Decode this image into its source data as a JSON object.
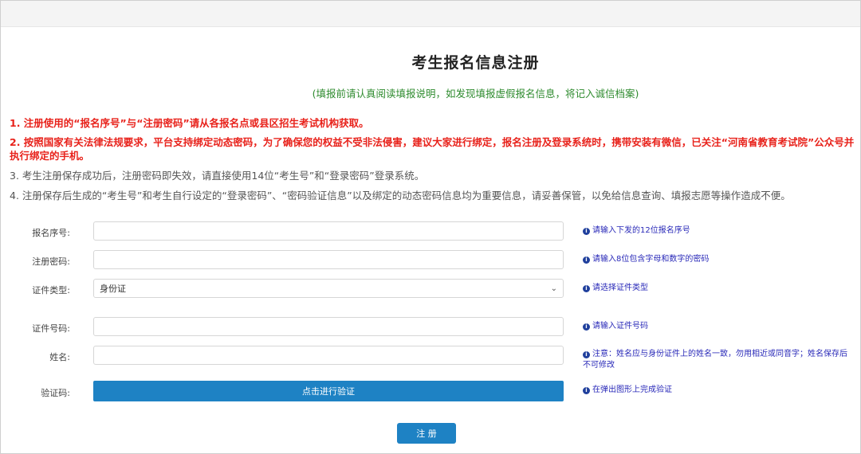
{
  "form": {
    "title": "考生报名信息注册",
    "subtitle": "(填报前请认真阅读填报说明，如发现填报虚假报名信息，将记入诚信档案)",
    "notes": [
      "1. 注册使用的“报名序号”与“注册密码”请从各报名点或县区招生考试机构获取。",
      "2. 按照国家有关法律法规要求，平台支持绑定动态密码，为了确保您的权益不受非法侵害，建议大家进行绑定，报名注册及登录系统时，携带安装有微信，已关注“河南省教育考试院”公众号并执行绑定的手机。",
      "3. 考生注册保存成功后，注册密码即失效，请直接使用14位“考生号”和“登录密码”登录系统。",
      "4. 注册保存后生成的“考生号”和考生自行设定的“登录密码”、“密码验证信息”以及绑定的动态密码信息均为重要信息，请妥善保管，以免给信息查询、填报志愿等操作造成不便。"
    ],
    "fields": {
      "serial": {
        "label": "报名序号:",
        "value": "",
        "hint": "请输入下发的12位报名序号"
      },
      "password": {
        "label": "注册密码:",
        "value": "",
        "hint": "请输入8位包含字母和数字的密码"
      },
      "id_type": {
        "label": "证件类型:",
        "value": "身份证",
        "hint": "请选择证件类型"
      },
      "id_number": {
        "label": "证件号码:",
        "value": "",
        "hint": "请输入证件号码"
      },
      "name": {
        "label": "姓名:",
        "value": "",
        "hint": "注意：姓名应与身份证件上的姓名一致，勿用相近或同音字；姓名保存后不可修改"
      },
      "captcha": {
        "label": "验证码:",
        "button": "点击进行验证",
        "hint": "在弹出图形上完成验证"
      }
    },
    "submit_label": "注 册"
  },
  "colors": {
    "primary": "#1e82c4",
    "warning": "#e8221b",
    "notice": "#2e8b2e",
    "hint": "#2929b8"
  },
  "icons": {
    "hint": "info-circle-icon",
    "select": "chevron-down-icon"
  }
}
